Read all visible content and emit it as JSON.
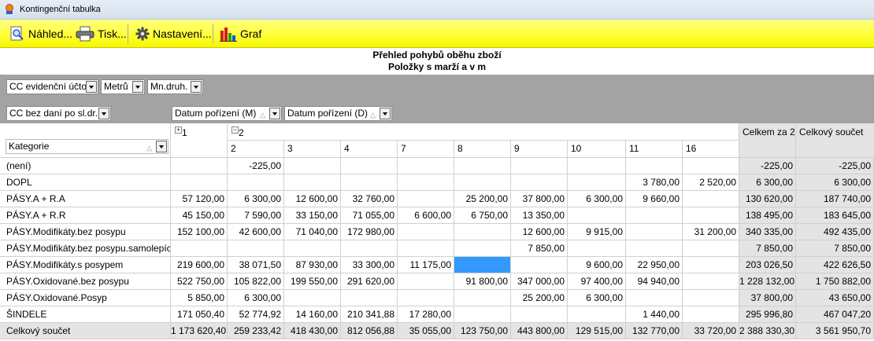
{
  "window": {
    "title": "Kontingenční tabulka"
  },
  "toolbar": {
    "preview_label": "Náhled...",
    "print_label": "Tisk...",
    "settings_label": "Nastavení...",
    "chart_label": "Graf"
  },
  "report": {
    "title_line1": "Přehled pohybů oběhu zboží",
    "title_line2": "Položky s marží a v m"
  },
  "filters": {
    "f1": "CC evidenční účto",
    "f2": "Metrů",
    "f3": "Mn.druh."
  },
  "row_field": "CC bez daní po sl.dr.",
  "column_fields": {
    "c1": "Datum pořízení (M)",
    "c2": "Datum pořízení (D)"
  },
  "category_label": "Kategorie",
  "col_groups": {
    "g1": "1",
    "g2": "2"
  },
  "columns": [
    "2",
    "3",
    "4",
    "7",
    "8",
    "9",
    "10",
    "11",
    "16"
  ],
  "subtotal_header": "Celkem za 2",
  "grand_header": "Celkový součet",
  "rows": [
    {
      "label": "(není)",
      "c1": "",
      "v": [
        "-225,00",
        "",
        "",
        "",
        "",
        "",
        "",
        "",
        ""
      ],
      "sub": "-225,00",
      "tot": "-225,00"
    },
    {
      "label": "DOPL",
      "c1": "",
      "v": [
        "",
        "",
        "",
        "",
        "",
        "",
        "",
        "3 780,00",
        "2 520,00"
      ],
      "sub": "6 300,00",
      "tot": "6 300,00"
    },
    {
      "label": "PÁSY.A + R.A",
      "c1": "57 120,00",
      "v": [
        "6 300,00",
        "12 600,00",
        "32 760,00",
        "",
        "25 200,00",
        "37 800,00",
        "6 300,00",
        "9 660,00",
        ""
      ],
      "sub": "130 620,00",
      "tot": "187 740,00"
    },
    {
      "label": "PÁSY.A + R.R",
      "c1": "45 150,00",
      "v": [
        "7 590,00",
        "33 150,00",
        "71 055,00",
        "6 600,00",
        "6 750,00",
        "13 350,00",
        "",
        "",
        ""
      ],
      "sub": "138 495,00",
      "tot": "183 645,00"
    },
    {
      "label": "PÁSY.Modifikáty.bez posypu",
      "c1": "152 100,00",
      "v": [
        "42 600,00",
        "71 040,00",
        "172 980,00",
        "",
        "",
        "12 600,00",
        "9 915,00",
        "",
        "31 200,00"
      ],
      "sub": "340 335,00",
      "tot": "492 435,00"
    },
    {
      "label": "PÁSY.Modifikáty.bez posypu.samolepící",
      "c1": "",
      "v": [
        "",
        "",
        "",
        "",
        "",
        "7 850,00",
        "",
        "",
        ""
      ],
      "sub": "7 850,00",
      "tot": "7 850,00"
    },
    {
      "label": "PÁSY.Modifikáty.s posypem",
      "c1": "219 600,00",
      "v": [
        "38 071,50",
        "87 930,00",
        "33 300,00",
        "11 175,00",
        "",
        "",
        "9 600,00",
        "22 950,00",
        ""
      ],
      "sub": "203 026,50",
      "tot": "422 626,50"
    },
    {
      "label": "PÁSY.Oxidované.bez posypu",
      "c1": "522 750,00",
      "v": [
        "105 822,00",
        "199 550,00",
        "291 620,00",
        "",
        "91 800,00",
        "347 000,00",
        "97 400,00",
        "94 940,00",
        ""
      ],
      "sub": "1 228 132,00",
      "tot": "1 750 882,00"
    },
    {
      "label": "PÁSY.Oxidované.Posyp",
      "c1": "5 850,00",
      "v": [
        "6 300,00",
        "",
        "",
        "",
        "",
        "25 200,00",
        "6 300,00",
        "",
        ""
      ],
      "sub": "37 800,00",
      "tot": "43 650,00"
    },
    {
      "label": "ŠINDELE",
      "c1": "171 050,40",
      "v": [
        "52 774,92",
        "14 160,00",
        "210 341,88",
        "17 280,00",
        "",
        "",
        "",
        "1 440,00",
        ""
      ],
      "sub": "295 996,80",
      "tot": "467 047,20"
    },
    {
      "label": "Celkový součet",
      "c1": "1 173 620,40",
      "v": [
        "259 233,42",
        "418 430,00",
        "812 056,88",
        "35 055,00",
        "123 750,00",
        "443 800,00",
        "129 515,00",
        "132 770,00",
        "33 720,00"
      ],
      "sub": "2 388 330,30",
      "tot": "3 561 950,70"
    }
  ],
  "colors": {
    "toolbar_yellow": "#ffff33",
    "selected_cell": "#3399ff",
    "band_gray": "#a3a3a3",
    "total_gray": "#e4e4e4"
  }
}
